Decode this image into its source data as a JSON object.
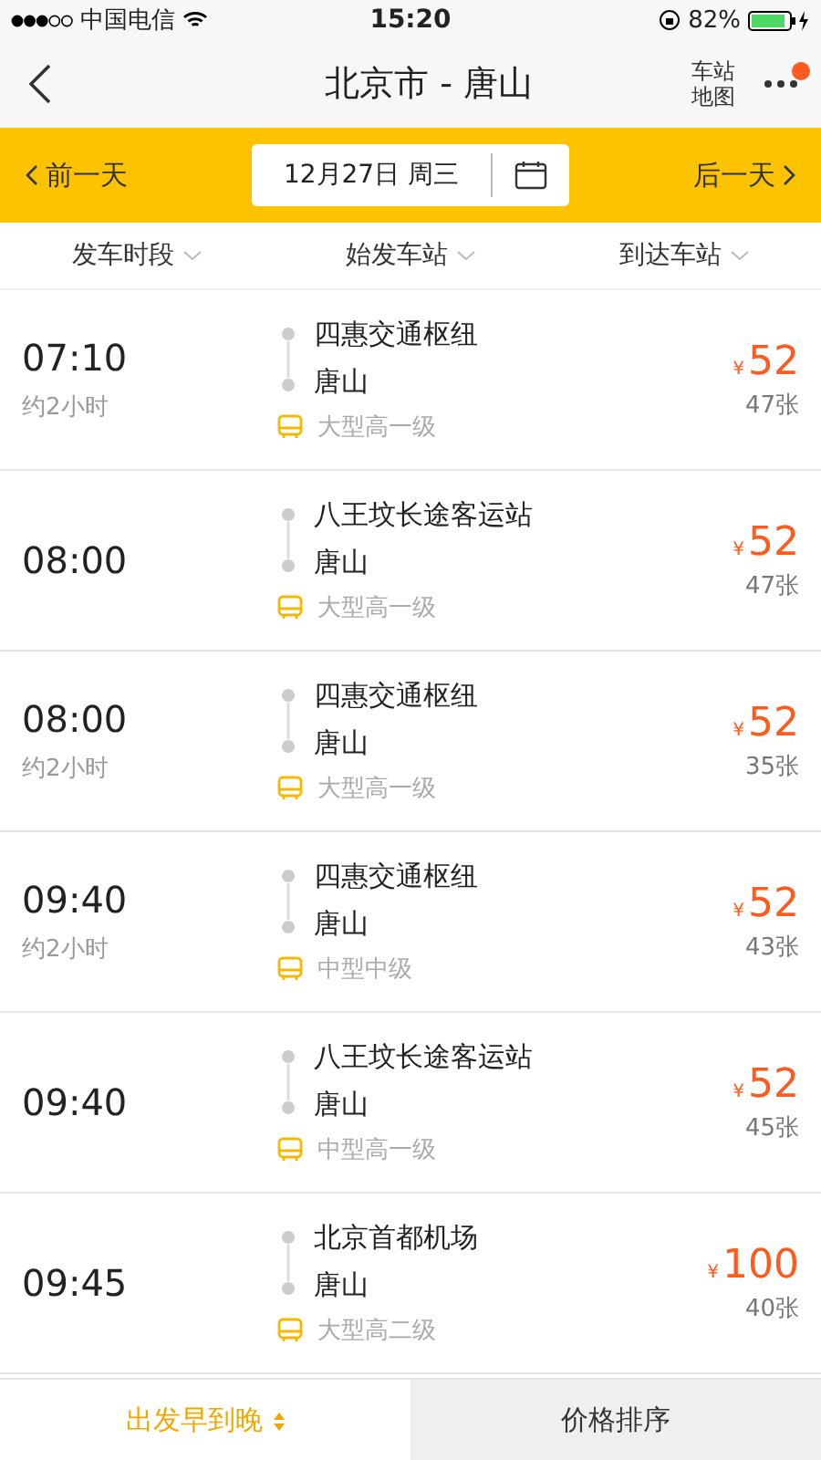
{
  "status_bar": {
    "carrier": "中国电信",
    "time": "15:20",
    "battery": "82%"
  },
  "nav": {
    "title": "北京市 - 唐山",
    "map_link": "车站地图",
    "has_notification": true
  },
  "date_bar": {
    "prev": "前一天",
    "date": "12月27日 周三",
    "next": "后一天"
  },
  "filters": [
    "发车时段",
    "始发车站",
    "到达车站"
  ],
  "trips": [
    {
      "time": "07:10",
      "duration": "约2小时",
      "from": "四惠交通枢纽",
      "to": "唐山",
      "bus_type": "大型高一级",
      "currency": "¥",
      "price": "52",
      "seats": "47张"
    },
    {
      "time": "08:00",
      "from": "八王坟长途客运站",
      "to": "唐山",
      "bus_type": "大型高一级",
      "currency": "¥",
      "price": "52",
      "seats": "47张"
    },
    {
      "time": "08:00",
      "duration": "约2小时",
      "from": "四惠交通枢纽",
      "to": "唐山",
      "bus_type": "大型高一级",
      "currency": "¥",
      "price": "52",
      "seats": "35张"
    },
    {
      "time": "09:40",
      "duration": "约2小时",
      "from": "四惠交通枢纽",
      "to": "唐山",
      "bus_type": "中型中级",
      "currency": "¥",
      "price": "52",
      "seats": "43张"
    },
    {
      "time": "09:40",
      "from": "八王坟长途客运站",
      "to": "唐山",
      "bus_type": "中型高一级",
      "currency": "¥",
      "price": "52",
      "seats": "45张"
    },
    {
      "time": "09:45",
      "from": "北京首都机场",
      "to": "唐山",
      "bus_type": "大型高二级",
      "currency": "¥",
      "price": "100",
      "seats": "40张"
    }
  ],
  "sort_tabs": [
    {
      "label": "出发早到晚",
      "selected": true
    },
    {
      "label": "价格排序",
      "selected": false
    }
  ]
}
